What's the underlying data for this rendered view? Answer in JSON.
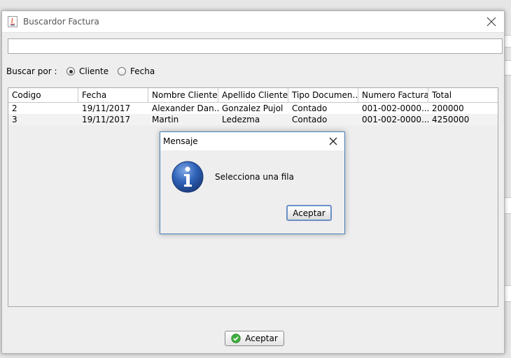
{
  "window": {
    "title": "Buscardor Factura"
  },
  "search": {
    "value": "",
    "placeholder": ""
  },
  "filter": {
    "label": "Buscar por :",
    "options": [
      {
        "label": "Cliente",
        "selected": true
      },
      {
        "label": "Fecha",
        "selected": false
      }
    ]
  },
  "table": {
    "columns": [
      "Codigo",
      "Fecha",
      "Nombre Cliente",
      "Apellido Cliente",
      "Tipo Documen...",
      "Numero Factura",
      "Total"
    ],
    "rows": [
      [
        "2",
        "19/11/2017",
        "Alexander Dan...",
        "Gonzalez Pujol",
        "Contado",
        "001-002-0000...",
        "200000"
      ],
      [
        "3",
        "19/11/2017",
        "Martin",
        "Ledezma",
        "Contado",
        "001-002-0000...",
        "4250000"
      ]
    ]
  },
  "footer": {
    "accept_label": "Aceptar"
  },
  "dialog": {
    "title": "Mensaje",
    "message": "Selecciona una fila",
    "button_label": "Aceptar",
    "icon": "info-icon"
  },
  "colors": {
    "info_blue": "#2e62b8",
    "check_green": "#3fae3f",
    "dialog_border": "#4a7fb8"
  }
}
